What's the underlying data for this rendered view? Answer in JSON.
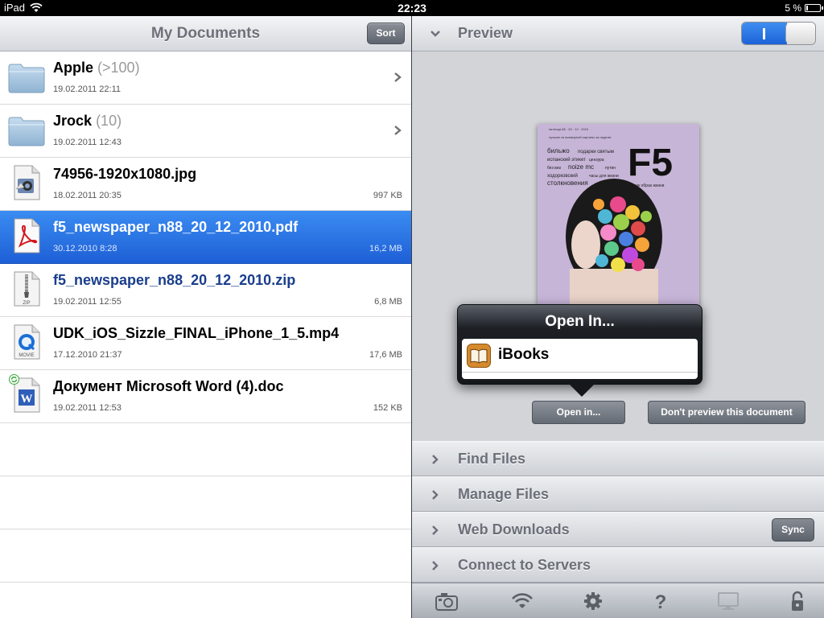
{
  "status_bar": {
    "carrier": "iPad",
    "time": "22:23",
    "battery": "5 %"
  },
  "left_pane": {
    "title": "My Documents",
    "sort_label": "Sort",
    "files": [
      {
        "name": "Apple",
        "count": "(>100)",
        "date": "19.02.2011 22:11",
        "size": "",
        "type": "folder"
      },
      {
        "name": "Jrock",
        "count": "(10)",
        "date": "19.02.2011 12:43",
        "size": "",
        "type": "folder"
      },
      {
        "name": "74956-1920x1080.jpg",
        "count": "",
        "date": "18.02.2011 20:35",
        "size": "997 KB",
        "type": "image"
      },
      {
        "name": "f5_newspaper_n88_20_12_2010.pdf",
        "count": "",
        "date": "30.12.2010 8:28",
        "size": "16,2 MB",
        "type": "pdf",
        "selected": true
      },
      {
        "name": "f5_newspaper_n88_20_12_2010.zip",
        "count": "",
        "date": "19.02.2011 12:55",
        "size": "6,8 MB",
        "type": "zip"
      },
      {
        "name": "UDK_iOS_Sizzle_FINAL_iPhone_1_5.mp4",
        "count": "",
        "date": "17.12.2010 21:37",
        "size": "17,6 MB",
        "type": "movie"
      },
      {
        "name": "Документ Microsoft Word (4).doc",
        "count": "",
        "date": "19.02.2011 12:53",
        "size": "152 KB",
        "type": "word"
      }
    ]
  },
  "right_pane": {
    "preview_title": "Preview",
    "preview_toggle_on": true,
    "thumbnail": {
      "masthead": "F5",
      "lines": [
        "бильжо",
        "подарки святым",
        "испанский этикет",
        "цензура",
        "без виз",
        "noize mc",
        "путин",
        "ходорковский",
        "часы для жизни",
        "столкновения",
        "как образ жизни"
      ]
    },
    "open_in_button": "Open in...",
    "dont_preview_button": "Don't preview this document",
    "popover": {
      "title": "Open In...",
      "items": [
        {
          "label": "iBooks"
        }
      ]
    },
    "sections": [
      {
        "title": "Find Files"
      },
      {
        "title": "Manage Files"
      },
      {
        "title": "Web Downloads",
        "button": "Sync"
      },
      {
        "title": "Connect to Servers"
      }
    ],
    "toolbar_icons": [
      "camera-icon",
      "wifi-icon",
      "gear-icon",
      "help-icon",
      "monitor-icon",
      "lock-icon"
    ]
  },
  "colors": {
    "selection": "#2a74e6",
    "header_text": "#6b6f78",
    "blue_filename": "#1a3e8c"
  }
}
